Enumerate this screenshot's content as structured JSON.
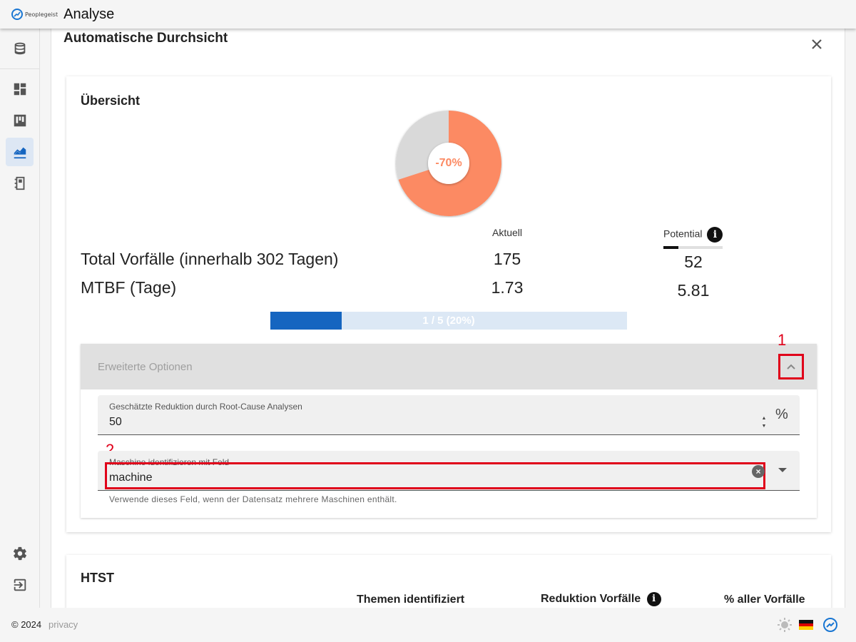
{
  "app": {
    "logo_text": "Peoplegeist",
    "title": "Analyse"
  },
  "nav": {
    "items": [
      {
        "name": "database",
        "icon": "database-icon"
      },
      {
        "name": "dashboard",
        "icon": "dashboard-icon"
      },
      {
        "name": "board",
        "icon": "kanban-icon"
      },
      {
        "name": "analytics",
        "icon": "analytics-icon",
        "active": true
      },
      {
        "name": "notebook",
        "icon": "notebook-icon"
      }
    ],
    "bottom": [
      {
        "name": "settings",
        "icon": "gear-icon"
      },
      {
        "name": "logout",
        "icon": "logout-icon"
      }
    ]
  },
  "dialog": {
    "title": "Automatische Durchsicht",
    "close_icon": "close-icon"
  },
  "overview": {
    "title": "Übersicht",
    "donut": {
      "label": "-70%",
      "reduction_fraction": 0.7,
      "color_reduction": "#fc8a63",
      "color_rest": "#d9d9d9"
    },
    "col_current": "Aktuell",
    "col_potential": "Potential",
    "potential_level": 0.25,
    "rows": [
      {
        "label": "Total Vorfälle (innerhalb 302 Tagen)",
        "current": "175",
        "potential": "52"
      },
      {
        "label": "MTBF (Tage)",
        "current": "1.73",
        "potential": "5.81"
      }
    ],
    "progress": {
      "text": "1 / 5 (20%)",
      "fraction": 0.2,
      "color": "#1565c0"
    }
  },
  "advanced": {
    "title": "Erweiterte Optionen",
    "annotation_1": "1",
    "annotation_2": "2",
    "reduction_field": {
      "label": "Geschätzte Reduktion durch Root-Cause Analysen",
      "value": "50",
      "suffix": "%"
    },
    "machine_field": {
      "label": "Maschine identifizieren mit Feld",
      "value": "machine",
      "hint": "Verwende dieses Feld, wenn der Datensatz mehrere Maschinen enthält."
    }
  },
  "htst": {
    "title": "HTST",
    "columns": [
      "Themen identifiziert",
      "Reduktion Vorfälle",
      "% aller Vorfälle"
    ]
  },
  "footer": {
    "copyright": "© 2024",
    "privacy": "privacy",
    "theme_icon": "sun-icon",
    "flag_icon": "german-flag-icon",
    "brand_icon": "peoplegeist-logo-icon"
  }
}
